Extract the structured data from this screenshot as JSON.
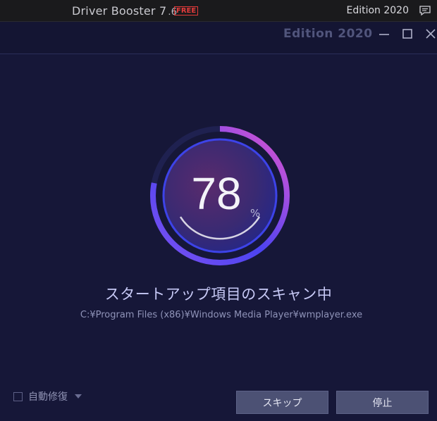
{
  "app": {
    "name": "Driver Booster 7",
    "version": ".6",
    "badge": "FREE",
    "edition": "Edition 2020"
  },
  "window": {
    "edition": "Edition 2020",
    "controls": [
      "minimize-icon",
      "maximize-icon",
      "close-icon"
    ]
  },
  "scan": {
    "progress": 78,
    "progress_value": "78",
    "unit": "%",
    "title": "スタートアップ項目のスキャン中",
    "path": "C:¥Program Files (x86)¥Windows Media Player¥wmplayer.exe"
  },
  "footer": {
    "auto_repair_label": "自動修復",
    "auto_repair_checked": false,
    "skip_label": "スキップ",
    "stop_label": "停止"
  },
  "colors": {
    "background": "#161738",
    "ring_start": "#e254c9",
    "ring_end": "#4b43f0",
    "free_badge": "#e23b3b"
  }
}
